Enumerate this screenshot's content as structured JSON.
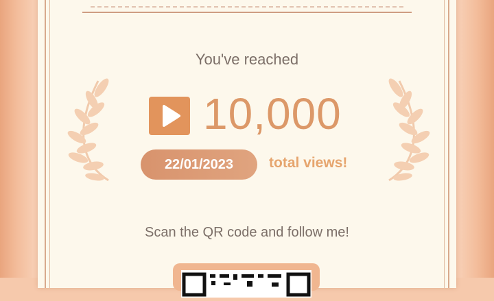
{
  "headline": "You've reached",
  "milestone": {
    "count": "10,000",
    "date": "22/01/2023",
    "suffix": "total views!"
  },
  "cta": "Scan the QR code and follow me!",
  "icons": {
    "play": "play-icon",
    "laurel": "laurel-icon",
    "qr": "qr-code-icon"
  },
  "colors": {
    "accent": "#dc9868",
    "background": "#fdf8ec",
    "frame": "#f6c9ac"
  }
}
